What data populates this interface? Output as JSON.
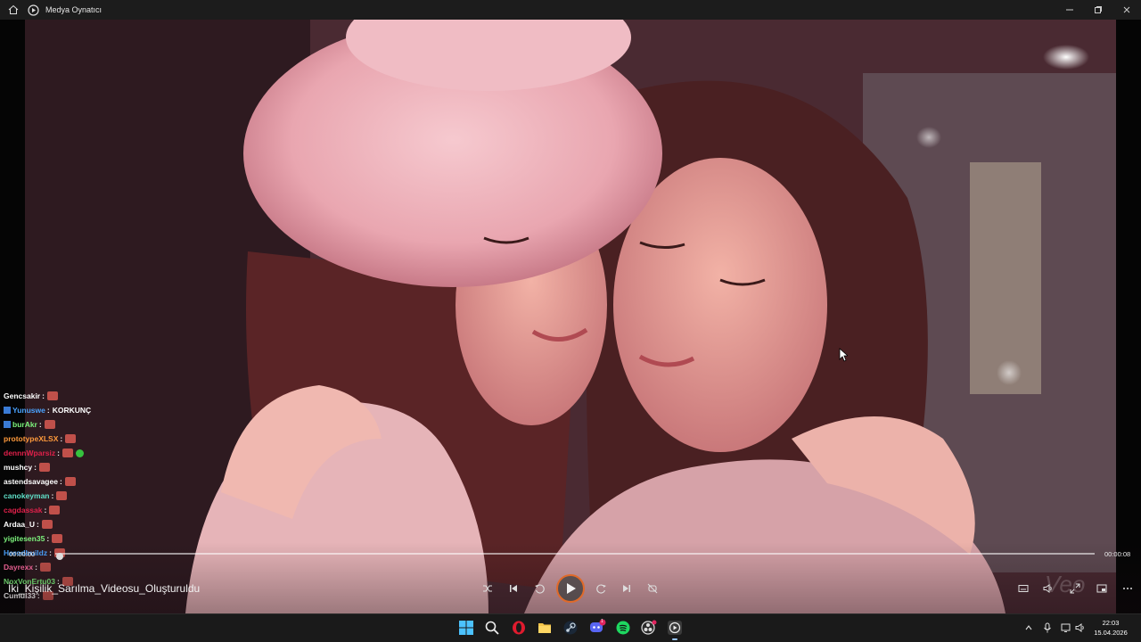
{
  "window": {
    "title": "Medya Oynatıcı"
  },
  "icons": {
    "home": "home-icon",
    "app": "media-player-icon",
    "minimize": "minimize-icon",
    "maximize": "restore-icon",
    "close": "close-icon"
  },
  "player": {
    "media_title": "İki_Kişilik_Sarılma_Videosu_Oluşturuldu",
    "time_elapsed": "00:00:00",
    "time_total": "00:00:08",
    "progress": 0.0,
    "state": "paused",
    "accent_color": "#e06a2a"
  },
  "chat": [
    {
      "user": "Gencsakir",
      "color": "#ffffff",
      "msg": "",
      "emote": true
    },
    {
      "user": "Yunuswe",
      "color": "#4aa3ff",
      "msg": "KORKUNÇ",
      "emote": false,
      "badges": true
    },
    {
      "user": "burAkr",
      "color": "#7cf27c",
      "msg": "",
      "emote": true,
      "badges": true
    },
    {
      "user": "prototypeXLSX",
      "color": "#ff9a3c",
      "msg": "",
      "emote": true
    },
    {
      "user": "dennnWparsiz",
      "color": "#e0204a",
      "msg": "",
      "emote": true,
      "green": true
    },
    {
      "user": "mushcy",
      "color": "#ffffff",
      "msg": "",
      "emote": true
    },
    {
      "user": "astendsavagee",
      "color": "#ffffff",
      "msg": "",
      "emote": true
    },
    {
      "user": "canokeyman",
      "color": "#5fe0c8",
      "msg": "",
      "emote": true
    },
    {
      "user": "cagdassak",
      "color": "#e0204a",
      "msg": "",
      "emote": true
    },
    {
      "user": "Ardaa_U",
      "color": "#ffffff",
      "msg": "",
      "emote": true
    },
    {
      "user": "yigitesen35",
      "color": "#7cf27c",
      "msg": "",
      "emote": true
    },
    {
      "user": "Herodbuildz",
      "color": "#4aa3ff",
      "msg": "",
      "emote": true
    },
    {
      "user": "Dayrexx",
      "color": "#ff6aa0",
      "msg": "",
      "emote": true
    },
    {
      "user": "NoxVonErtu03",
      "color": "#7cf27c",
      "msg": "",
      "emote": true
    },
    {
      "user": "Cumul33",
      "color": "#ffffff",
      "msg": "",
      "emote": true
    }
  ],
  "controls": {
    "shuffle": "shuffle-icon",
    "previous": "previous-icon",
    "rewind": "rewind-10-icon",
    "play": "play-icon",
    "forward": "forward-30-icon",
    "next": "next-icon",
    "repeat": "repeat-off-icon",
    "subtitles": "subtitles-icon",
    "volume": "volume-icon",
    "fullscreen": "fullscreen-icon",
    "miniplayer": "miniplayer-icon",
    "more": "more-icon"
  },
  "watermark": "Veo",
  "taskbar": {
    "apps": [
      "windows-start-icon",
      "search-icon",
      "opera-icon",
      "file-explorer-icon",
      "steam-icon",
      "discord-icon",
      "spotify-icon",
      "obs-icon",
      "media-player-icon"
    ],
    "discord_badge": "1",
    "time": "22:03",
    "date": "15.04.2026"
  }
}
